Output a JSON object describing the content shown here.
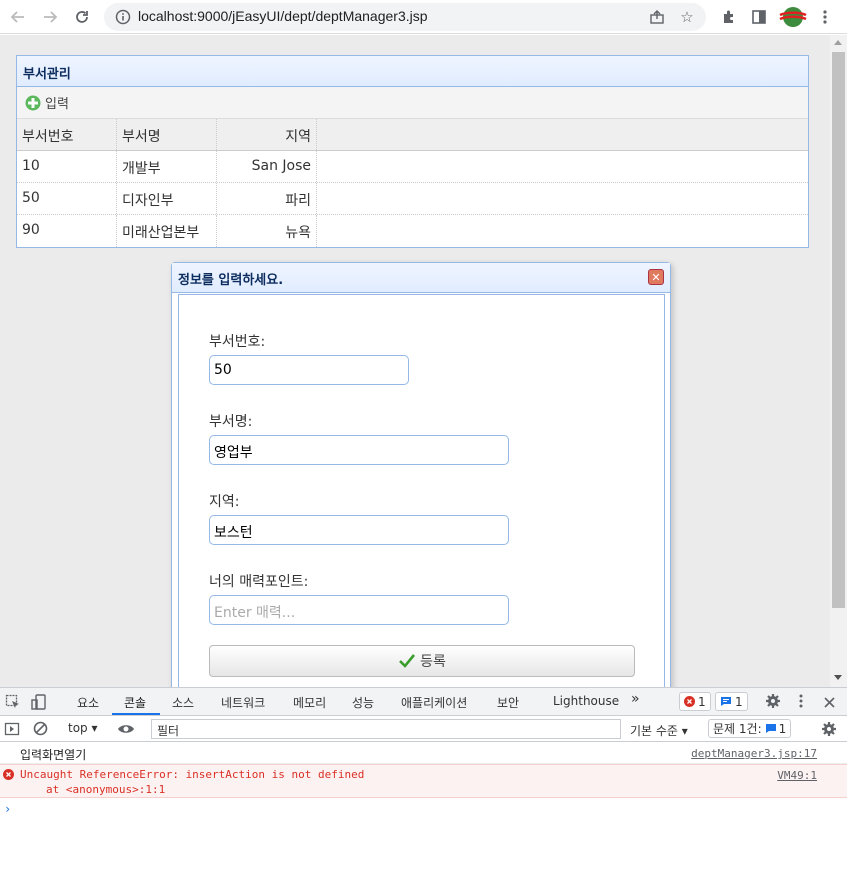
{
  "browser": {
    "url": "localhost:9000/jEasyUI/dept/deptManager3.jsp"
  },
  "panel": {
    "title": "부서관리",
    "add_label": "입력"
  },
  "grid": {
    "columns": [
      "부서번호",
      "부서명",
      "지역"
    ],
    "rows": [
      [
        "10",
        "개발부",
        "San Jose"
      ],
      [
        "50",
        "디자인부",
        "파리"
      ],
      [
        "90",
        "미래산업본부",
        "뉴욕"
      ]
    ]
  },
  "dialog": {
    "title": "정보를 입력하세요.",
    "fields": [
      {
        "label": "부서번호:",
        "value": "50",
        "placeholder": ""
      },
      {
        "label": "부서명:",
        "value": "영업부",
        "placeholder": ""
      },
      {
        "label": "지역:",
        "value": "보스턴",
        "placeholder": ""
      },
      {
        "label": "너의 매력포인트:",
        "value": "",
        "placeholder": "Enter 매력..."
      }
    ],
    "submit_label": "등록"
  },
  "devtools": {
    "tabs": [
      "요소",
      "콘솔",
      "소스",
      "네트워크",
      "메모리",
      "성능",
      "애플리케이션",
      "보안",
      "Lighthouse"
    ],
    "active_tab": "콘솔",
    "error_count": "1",
    "info_count": "1",
    "context": "top",
    "filter_placeholder": "필터",
    "level": "기본 수준",
    "issues_label": "문제 1건:",
    "issues_count": "1",
    "logs": [
      {
        "text": "입력화면열기",
        "source": "deptManager3.jsp:17"
      },
      {
        "text": "Uncaught ReferenceError: insertAction is not defined",
        "detail": "at <anonymous>:1:1",
        "source": "VM49:1"
      }
    ]
  },
  "colors": {
    "panel_border": "#95b8e7",
    "header_text": "#0e2d5f",
    "error_bg": "#fdf2f2",
    "error_text": "#d93025",
    "devtools_accent": "#1a73e8"
  }
}
